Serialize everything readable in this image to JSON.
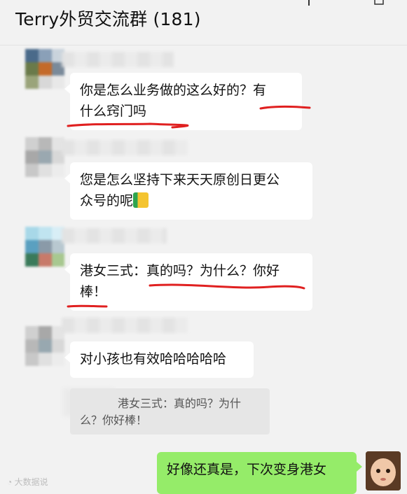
{
  "header": {
    "title": "Terry外贸交流群 (181)"
  },
  "messages": [
    {
      "lines": [
        "你是怎么业务做的这么好的？有",
        "什么窍门吗"
      ],
      "underlined": true
    },
    {
      "lines": [
        "您是怎么坚持下来天天原创日更公",
        "众号的呢"
      ],
      "emoji": "thumbs-up-icon"
    },
    {
      "lines": [
        "港女三式：真的吗？为什么？你好",
        "棒！"
      ],
      "underlined": true
    },
    {
      "lines": [
        "对小孩也有效哈哈哈哈哈"
      ]
    }
  ],
  "quote": {
    "lines": [
      "港女三式：真的吗？为什",
      "么？你好棒！"
    ]
  },
  "self_message": {
    "text": "好像还真是，下次变身港女"
  },
  "watermark": {
    "text": "大数据说"
  },
  "colors": {
    "background": "#f2f2f2",
    "incoming_bubble": "#ffffff",
    "outgoing_bubble": "#95ec69",
    "annotation_red": "#e02020"
  }
}
